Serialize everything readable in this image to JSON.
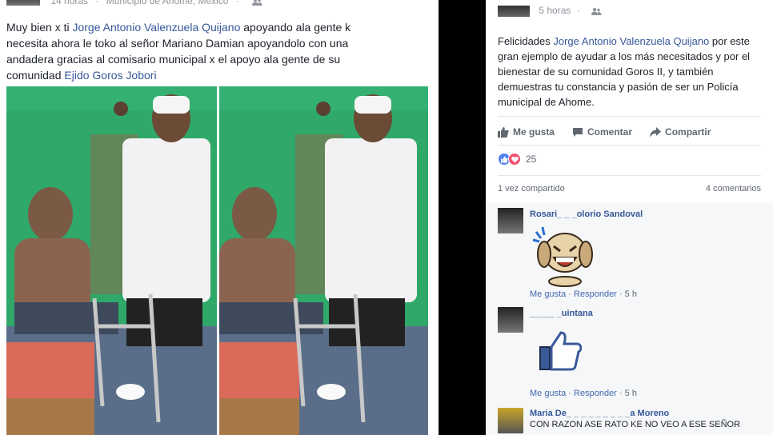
{
  "left_post": {
    "time": "14 horas",
    "location": "Municipio de Ahome, México",
    "text_prefix": "Muy bien x ti ",
    "mention": "Jorge Antonio Valenzuela Quijano",
    "text_middle": " apoyando ala gente k necesita ahora le toko al señor Mariano Damian apoyandolo con una andadera gracias al comisario municipal x el apoyo ala gente de su comunidad ",
    "place_link": "Ejido Goros Jobori"
  },
  "right_post": {
    "time": "5 horas",
    "text_prefix": "Felicidades ",
    "mention": "Jorge Antonio Valenzuela Quijano",
    "text_rest": " por este gran ejemplo de ayudar a los más necesitados y por el bienestar de su comunidad Goros II, y también demuestras tu constancia y pasión de ser un Policía municipal de Ahome.",
    "actions": {
      "like": "Me gusta",
      "comment": "Comentar",
      "share": "Compartir"
    },
    "reaction_count": "25",
    "shared_text": "1 vez compartido",
    "comments_count_text": "4 comentarios"
  },
  "comments": [
    {
      "name": "Rosari_ _ _olorio Sandoval",
      "like": "Me gusta",
      "reply": "Responder",
      "time": "5 h"
    },
    {
      "name": "_____ _uintana",
      "like": "Me gusta",
      "reply": "Responder",
      "time": "5 h"
    },
    {
      "name": "Maria De_ _ _ _ _ _ _ _ _a Moreno",
      "body": "CON RAZON ASE RATO KE NO VEO A ESE SEÑOR"
    }
  ],
  "icons": {
    "friends": "friends-icon",
    "like": "thumbs-up-icon",
    "comment": "comment-icon",
    "share": "share-arrow-icon",
    "like_reaction": "like-reaction-icon",
    "love_reaction": "love-reaction-icon"
  },
  "colors": {
    "link": "#365899",
    "meta": "#90949c",
    "like_reaction": "#4f7ff0",
    "love_reaction": "#f0506e",
    "wall_green": "#2fa86a"
  }
}
